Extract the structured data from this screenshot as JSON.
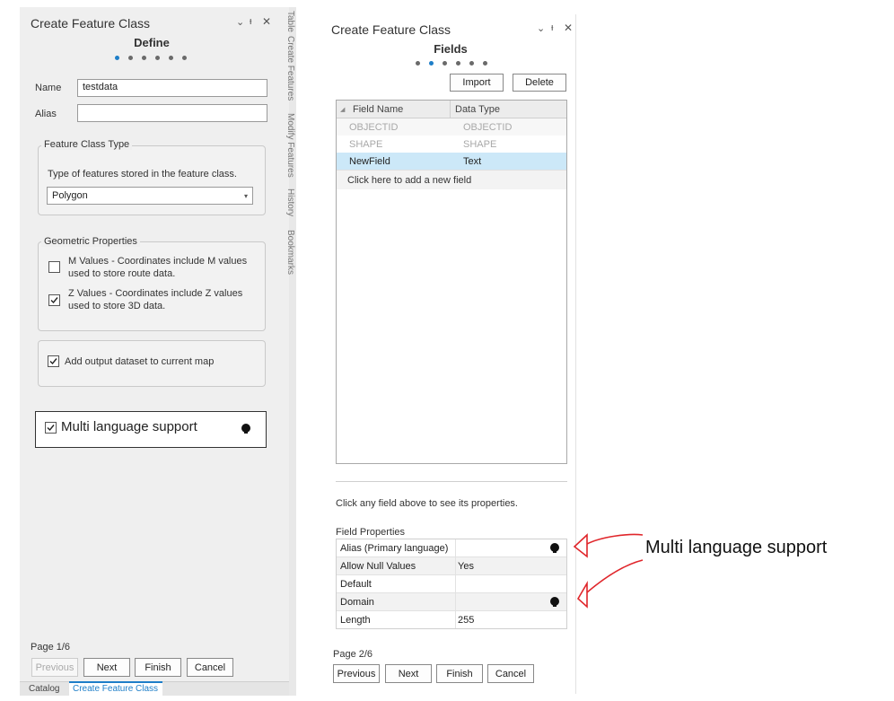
{
  "left": {
    "title": "Create Feature Class",
    "controls": {
      "dropdown": "⌄",
      "pin": "ᵻ",
      "close": "✕"
    },
    "step_title": "Define",
    "name_label": "Name",
    "name_value": "testdata",
    "alias_label": "Alias",
    "alias_value": "",
    "fc_type_legend": "Feature Class Type",
    "fc_type_desc": "Type of features stored in the feature class.",
    "fc_type_value": "Polygon",
    "geom_legend": "Geometric Properties",
    "m_values_text": "M Values - Coordinates include M values used to store route data.",
    "z_values_text": "Z Values - Coordinates include Z values used to store 3D data.",
    "add_output_text": "Add output dataset to current map",
    "multi_lang_text": "Multi language support",
    "page_indicator": "Page 1/6",
    "buttons": {
      "previous": "Previous",
      "next": "Next",
      "finish": "Finish",
      "cancel": "Cancel"
    },
    "bottom_tabs": {
      "catalog": "Catalog",
      "create": "Create Feature Class"
    },
    "side_tabs": [
      "Table",
      "Create Features",
      "Modify Features",
      "History",
      "Bookmarks"
    ]
  },
  "right": {
    "title": "Create Feature Class",
    "controls": {
      "dropdown": "⌄",
      "pin": "ᵻ",
      "close": "✕"
    },
    "step_title": "Fields",
    "import_label": "Import",
    "delete_label": "Delete",
    "grid_headers": [
      "Field Name",
      "Data Type"
    ],
    "grid_rows": [
      {
        "name": "OBJECTID",
        "type": "OBJECTID"
      },
      {
        "name": "SHAPE",
        "type": "SHAPE"
      },
      {
        "name": "NewField",
        "type": "Text"
      }
    ],
    "add_field_text": "Click here to add a new field",
    "hint_text": "Click any field above to see its properties.",
    "props_title": "Field Properties",
    "props_rows": [
      {
        "label": "Alias (Primary language)",
        "value": ""
      },
      {
        "label": "Allow Null Values",
        "value": "Yes"
      },
      {
        "label": "Default",
        "value": ""
      },
      {
        "label": "Domain",
        "value": ""
      },
      {
        "label": "Length",
        "value": "255"
      }
    ],
    "page_indicator": "Page 2/6",
    "buttons": {
      "previous": "Previous",
      "next": "Next",
      "finish": "Finish",
      "cancel": "Cancel"
    }
  },
  "annotation": {
    "text": "Multi language support",
    "arrow_color": "#e0262b"
  },
  "colors": {
    "accent": "#1e7ec8",
    "selected_row": "#cce8f8",
    "annotation": "#e0262b"
  }
}
